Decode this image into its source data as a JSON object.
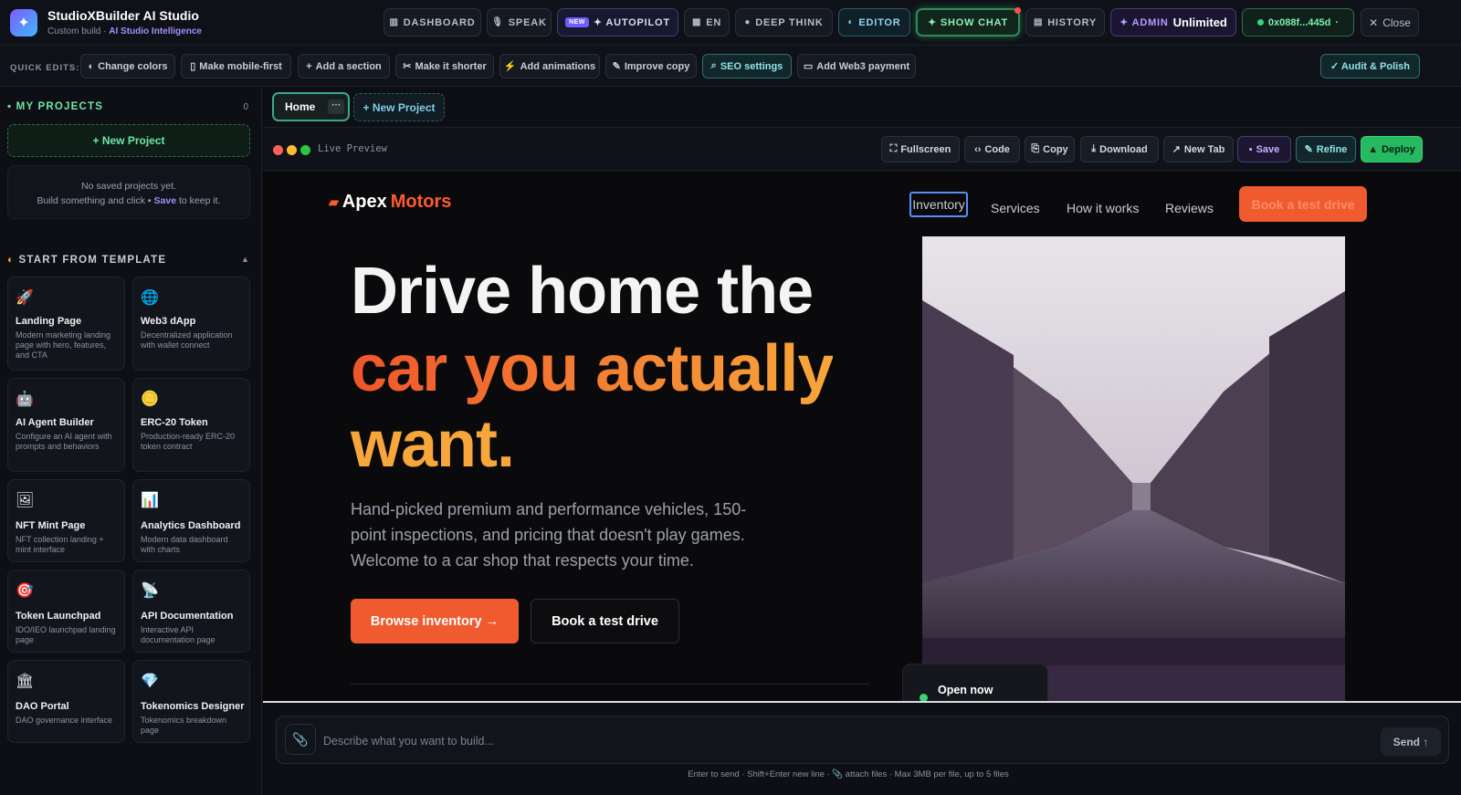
{
  "app": {
    "title": "StudioXBuilder AI Studio",
    "sub_prefix": "Custom build",
    "sub_sep": "·",
    "sub_hl": "AI Studio Intelligence"
  },
  "topbar": {
    "dashboard": "DASHBOARD",
    "speak": "SPEAK",
    "new_badge": "NEW",
    "autopilot": "✦ AUTOPILOT",
    "lang": "EN",
    "deep_think": "DEEP THINK",
    "editor": "EDITOR",
    "show_chat": "✦ SHOW CHAT",
    "history": "HISTORY",
    "admin": "✦ ADMIN",
    "plan": "Unlimited",
    "wallet": "0x088f...445d",
    "close": "Close"
  },
  "quick_edits": {
    "label": "QUICK EDITS:",
    "items": [
      "Change colors",
      "Make mobile-first",
      "Add a section",
      "Make it shorter",
      "Add animations",
      "Improve copy",
      "SEO settings",
      "Add Web3 payment"
    ],
    "audit": "✓ Audit & Polish"
  },
  "sidebar": {
    "projects_title": "MY PROJECTS",
    "projects_count": "0",
    "new_project": "+ New Project",
    "empty_line1": "No saved projects yet.",
    "empty_line2_pre": "Build something and click",
    "empty_save": "Save",
    "empty_line2_post": "to keep it.",
    "templates_title": "START FROM TEMPLATE",
    "templates_toggle": "▲",
    "templates": [
      {
        "name": "Landing Page",
        "desc": "Modern marketing landing page with hero, features, and CTA",
        "icon": "🚀"
      },
      {
        "name": "Web3 dApp",
        "desc": "Decentralized application with wallet connect",
        "icon": "🌐"
      },
      {
        "name": "AI Agent Builder",
        "desc": "Configure an AI agent with prompts and behaviors",
        "icon": "🤖"
      },
      {
        "name": "ERC-20 Token",
        "desc": "Production-ready ERC-20 token contract",
        "icon": "🪙"
      },
      {
        "name": "NFT Mint Page",
        "desc": "NFT collection landing + mint interface",
        "icon": "🖼"
      },
      {
        "name": "Analytics Dashboard",
        "desc": "Modern data dashboard with charts",
        "icon": "📊"
      },
      {
        "name": "Token Launchpad",
        "desc": "IDO/IEO launchpad landing page",
        "icon": "🎯"
      },
      {
        "name": "API Documentation",
        "desc": "Interactive API documentation page",
        "icon": "📡"
      },
      {
        "name": "DAO Portal",
        "desc": "DAO governance interface",
        "icon": "🏛"
      },
      {
        "name": "Tokenomics Designer",
        "desc": "Tokenomics breakdown page",
        "icon": "💎"
      }
    ]
  },
  "tabs": {
    "home": "Home",
    "home_menu": "···",
    "new_project": "+ New Project"
  },
  "preview_bar": {
    "label": "Live Preview",
    "buttons": [
      "Fullscreen",
      "Code",
      "Copy",
      "Download",
      "New Tab",
      "Save",
      "Refine",
      "Deploy"
    ]
  },
  "site": {
    "logo_a": "Apex",
    "logo_b": "Motors",
    "nav": [
      "Inventory",
      "Services",
      "How it works",
      "Reviews"
    ],
    "nav_cta": "Book a test drive",
    "hero_l1": "Drive home the",
    "hero_l2": "car you actually",
    "hero_l3": "want.",
    "hero_p": "Hand-picked premium and performance vehicles, 150-point inspections, and pricing that doesn't play games. Welcome to a car shop that respects your time.",
    "btn_primary": "Browse inventory →",
    "btn_secondary": "Book a test drive",
    "open_now": "Open now"
  },
  "composer": {
    "placeholder": "Describe what you want to build...",
    "send": "Send ↑",
    "hint": "Enter to send · Shift+Enter new line · 📎 attach files · Max 3MB per file, up to 5 files"
  }
}
